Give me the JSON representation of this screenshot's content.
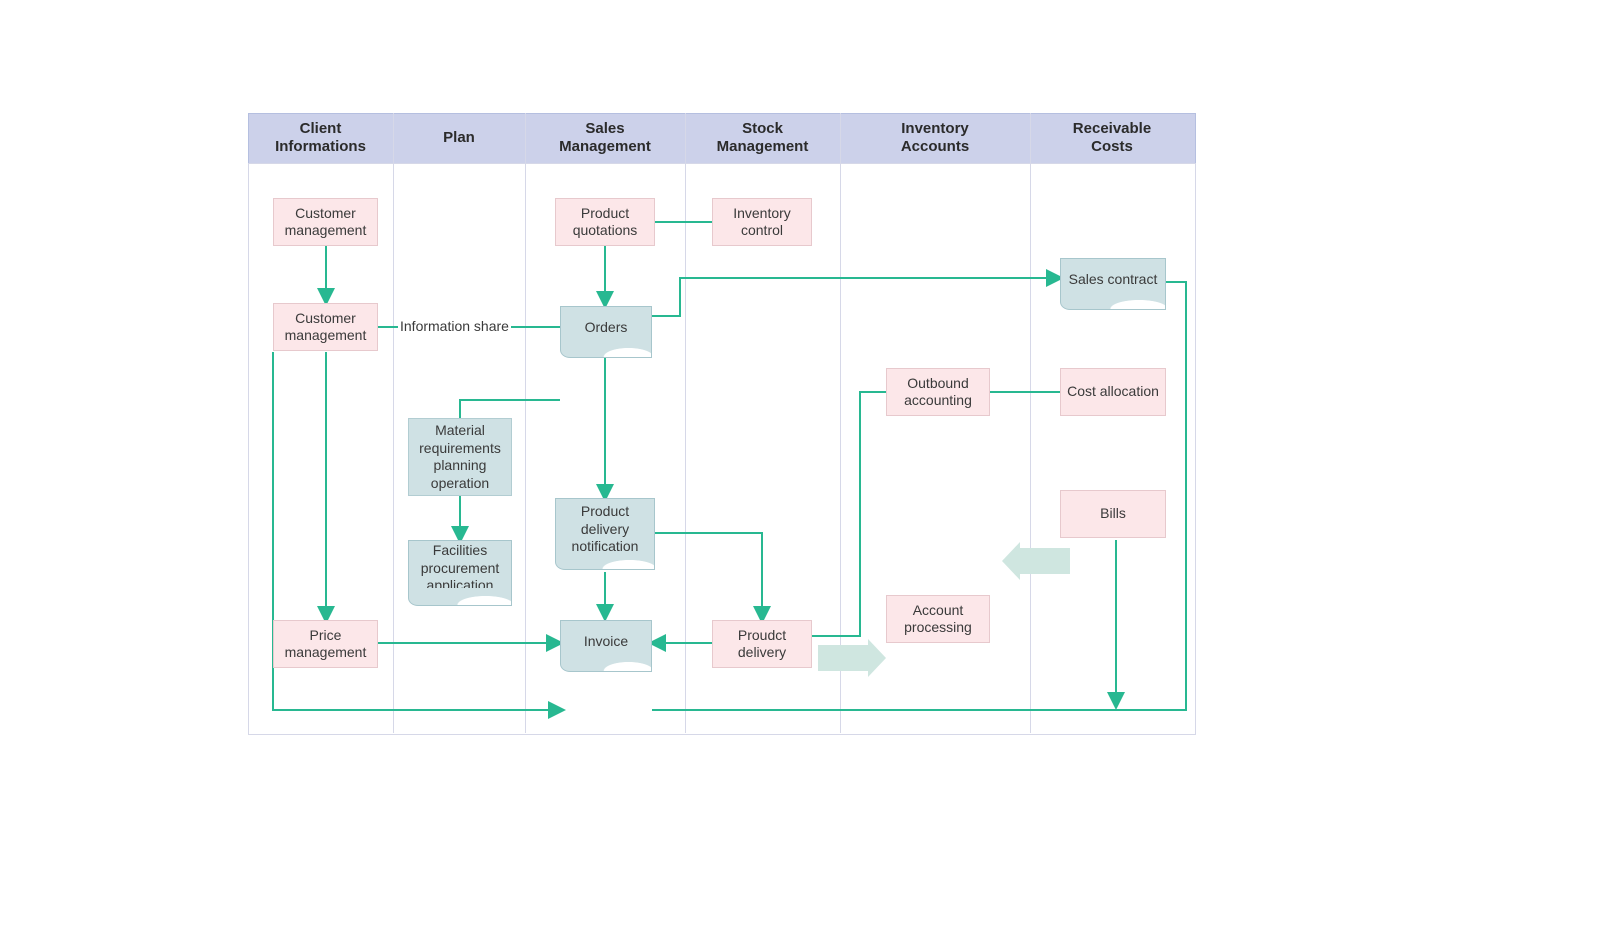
{
  "columns": {
    "client": "Client\nInformations",
    "plan": "Plan",
    "sales": "Sales\nManagement",
    "stock": "Stock\nManagement",
    "inventory": "Inventory\nAccounts",
    "receivable": "Receivable\nCosts"
  },
  "nodes": {
    "cust_mgmt_1": "Customer management",
    "cust_mgmt_2": "Customer management",
    "price_mgmt": "Price management",
    "mrp": "Material requirements planning operation",
    "fac_proc": "Facilities procurement application",
    "prod_quot": "Product quotations",
    "orders": "Orders",
    "pdn": "Product delivery notification",
    "invoice": "Invoice",
    "inv_ctrl": "Inventory control",
    "prod_deliv": "Proudct delivery",
    "out_acct": "Outbound accounting",
    "acct_proc": "Account processing",
    "sales_contract": "Sales contract",
    "cost_alloc": "Cost allocation",
    "bills": "Bills"
  },
  "labels": {
    "info_share": "Information share"
  },
  "colors": {
    "stroke": "#28b891",
    "header_bg": "#ccd1ea",
    "pink": "#fce7e9",
    "blue": "#cfe1e4"
  }
}
